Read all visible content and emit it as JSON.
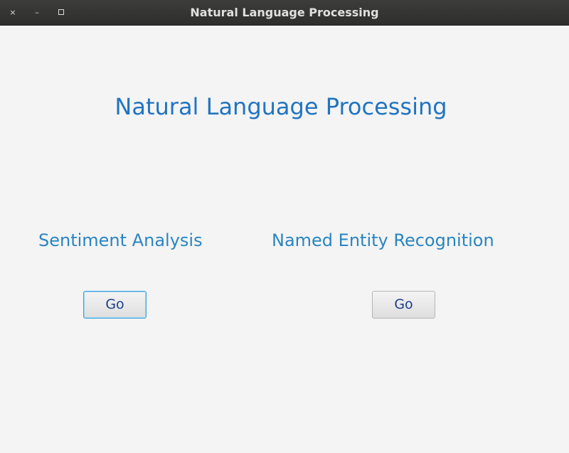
{
  "window": {
    "title": "Natural Language Processing",
    "controls": {
      "close_icon": "×",
      "minimize_icon": "–"
    }
  },
  "main": {
    "heading": "Natural Language Processing",
    "sections": [
      {
        "label": "Sentiment Analysis",
        "button_label": "Go",
        "focused": true
      },
      {
        "label": "Named Entity Recognition",
        "button_label": "Go",
        "focused": false
      }
    ]
  },
  "colors": {
    "heading": "#2074c0",
    "section_label": "#2a85c0",
    "button_text": "#1c3e8a",
    "focus_ring": "#3aa3dd",
    "background": "#f4f4f4",
    "titlebar": "#2e2f2d"
  }
}
